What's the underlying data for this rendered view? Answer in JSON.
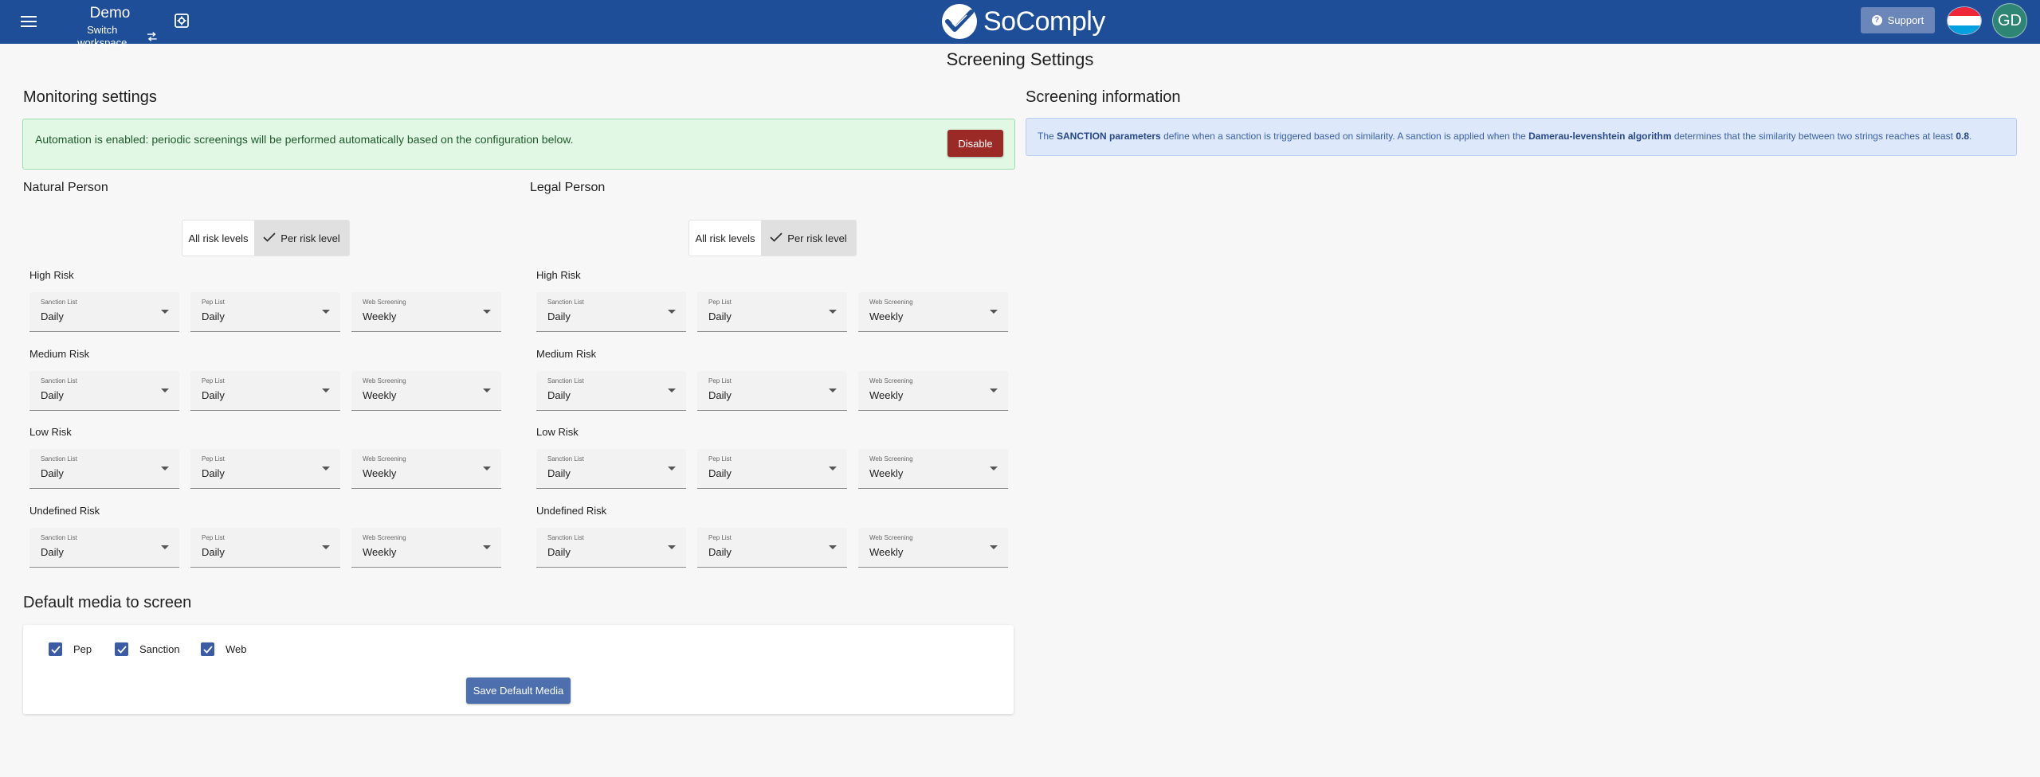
{
  "header": {
    "workspace_name": "Demo",
    "switch_workspace": "Switch workspace",
    "logo_text": "SoComply",
    "support_label": "Support",
    "avatar_initials": "GD",
    "flag_colors": [
      "#ed2939",
      "#ffffff",
      "#00a1de"
    ]
  },
  "page": {
    "title": "Screening Settings"
  },
  "monitoring": {
    "title": "Monitoring settings",
    "automation_message": "Automation is enabled: periodic screenings will be performed automatically based on the configuration below.",
    "disable_label": "Disable"
  },
  "screening_info": {
    "title": "Screening information",
    "text_1": "The ",
    "sanction_params": "SANCTION parameters",
    "text_2": " define when a sanction is triggered based on similarity. A sanction is applied when the ",
    "algorithm": "Damerau-levenshtein algorithm",
    "text_3": " determines that the similarity between two strings reaches at least ",
    "threshold": "0.8",
    "text_4": "."
  },
  "toggle": {
    "all_label": "All risk levels",
    "per_label": "Per risk level",
    "selected": "per"
  },
  "field_labels": {
    "sanction": "Sanction List",
    "pep": "Pep List",
    "web": "Web Screening"
  },
  "natural_person": {
    "title": "Natural Person",
    "levels": [
      {
        "label": "High Risk",
        "sanction": "Daily",
        "pep": "Daily",
        "web": "Weekly"
      },
      {
        "label": "Medium Risk",
        "sanction": "Daily",
        "pep": "Daily",
        "web": "Weekly"
      },
      {
        "label": "Low Risk",
        "sanction": "Daily",
        "pep": "Daily",
        "web": "Weekly"
      },
      {
        "label": "Undefined Risk",
        "sanction": "Daily",
        "pep": "Daily",
        "web": "Weekly"
      }
    ]
  },
  "legal_person": {
    "title": "Legal Person",
    "levels": [
      {
        "label": "High Risk",
        "sanction": "Daily",
        "pep": "Daily",
        "web": "Weekly"
      },
      {
        "label": "Medium Risk",
        "sanction": "Daily",
        "pep": "Daily",
        "web": "Weekly"
      },
      {
        "label": "Low Risk",
        "sanction": "Daily",
        "pep": "Daily",
        "web": "Weekly"
      },
      {
        "label": "Undefined Risk",
        "sanction": "Daily",
        "pep": "Daily",
        "web": "Weekly"
      }
    ]
  },
  "default_media": {
    "title": "Default media to screen",
    "pep_label": "Pep",
    "sanction_label": "Sanction",
    "web_label": "Web",
    "save_label": "Save Default Media"
  }
}
